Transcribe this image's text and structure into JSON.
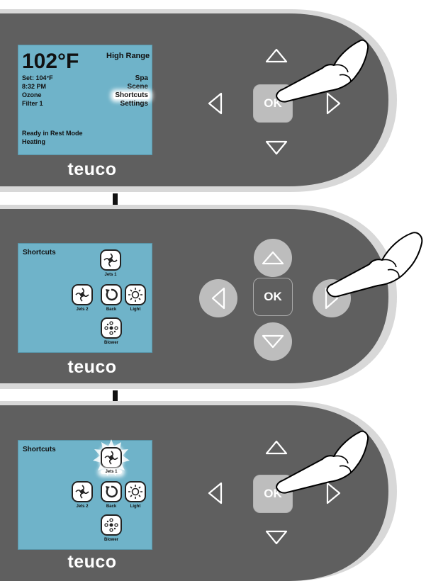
{
  "brand": "teuco",
  "ok_label": "OK",
  "panel1": {
    "temperature": "102°F",
    "range": "High Range",
    "set_temp": "Set: 104°F",
    "time": "8:32 PM",
    "ozone": "Ozone",
    "filter": "Filter 1",
    "menu": [
      "Spa",
      "Scene",
      "Shortcuts",
      "Settings"
    ],
    "selected_menu": "Shortcuts",
    "status_line1": "Ready in Rest Mode",
    "status_line2": "Heating"
  },
  "panel2": {
    "title": "Shortcuts",
    "icons": {
      "jets1": "Jets 1",
      "jets2": "Jets 2",
      "back": "Back",
      "light": "Light",
      "blower": "Blower"
    }
  },
  "panel3": {
    "title": "Shortcuts",
    "icons": {
      "jets1": "Jets 1",
      "jets2": "Jets 2",
      "back": "Back",
      "light": "Light",
      "blower": "Blower"
    },
    "selected_icon": "Jets 1"
  },
  "colors": {
    "panel": "#5f5f5f",
    "screen": "#6fb3c9",
    "outline": "#d9d9d9"
  }
}
